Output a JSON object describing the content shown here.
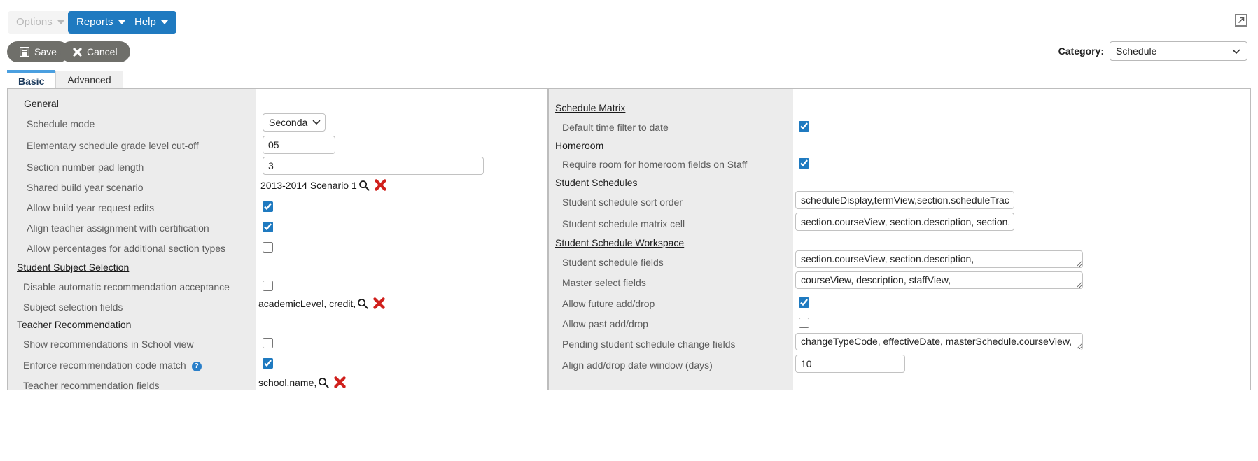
{
  "toolbar": {
    "options_label": "Options",
    "reports_label": "Reports",
    "help_label": "Help",
    "save_label": "Save",
    "cancel_label": "Cancel",
    "expand_icon": "expand-window-icon"
  },
  "category": {
    "label": "Category:",
    "value": "Schedule",
    "options": [
      "Schedule"
    ]
  },
  "tabs": [
    {
      "label": "Basic",
      "active": true
    },
    {
      "label": "Advanced",
      "active": false
    }
  ],
  "left_panel": {
    "sections": [
      {
        "title": "General",
        "rows": [
          {
            "label": "Schedule mode",
            "type": "select",
            "value": "Secondary",
            "options": [
              "Secondary"
            ]
          },
          {
            "label": "Elementary schedule grade level cut-off",
            "type": "text",
            "value": "05"
          },
          {
            "label": "Section number pad length",
            "type": "text",
            "value": "3"
          },
          {
            "label": "Shared build year scenario",
            "type": "picker",
            "value": "2013-2014 Scenario 1"
          },
          {
            "label": "Allow build year request edits",
            "type": "checkbox",
            "value": true
          },
          {
            "label": "Align teacher assignment with certification",
            "type": "checkbox",
            "value": true
          },
          {
            "label": "Allow percentages for additional section types",
            "type": "checkbox",
            "value": false
          }
        ]
      },
      {
        "title": "Student Subject Selection",
        "rows": [
          {
            "label": "Disable automatic recommendation acceptance",
            "type": "checkbox",
            "value": false
          },
          {
            "label": "Subject selection fields",
            "type": "picker",
            "value": "academicLevel, credit,"
          }
        ]
      },
      {
        "title": "Teacher Recommendation",
        "rows": [
          {
            "label": "Show recommendations in School view",
            "type": "checkbox",
            "value": false
          },
          {
            "label": "Enforce recommendation code match",
            "type": "checkbox",
            "value": true,
            "help": "?"
          },
          {
            "label": "Teacher recommendation fields",
            "type": "picker",
            "value": "school.name,"
          }
        ]
      }
    ]
  },
  "right_panel": {
    "sections": [
      {
        "title": "Schedule Matrix",
        "rows": [
          {
            "label": "Default time filter to date",
            "type": "checkbox",
            "value": true
          }
        ]
      },
      {
        "title": "Homeroom",
        "rows": [
          {
            "label": "Require room for homeroom fields on Staff",
            "type": "checkbox",
            "value": true
          }
        ]
      },
      {
        "title": "Student Schedules",
        "rows": [
          {
            "label": "Student schedule sort order",
            "type": "text",
            "value": "scheduleDisplay,termView,section.scheduleTrackId,sectio"
          },
          {
            "label": "Student schedule matrix cell",
            "type": "text",
            "value": "section.courseView, section.description, section.staffView"
          }
        ]
      },
      {
        "title": "Student Schedule Workspace",
        "rows": [
          {
            "label": "Student schedule fields",
            "type": "textarea",
            "value": "section.courseView, section.description,"
          },
          {
            "label": "Master select fields",
            "type": "textarea",
            "value": "courseView, description, staffView,"
          },
          {
            "label": "Allow future add/drop",
            "type": "checkbox",
            "value": true
          },
          {
            "label": "Allow past add/drop",
            "type": "checkbox",
            "value": false
          },
          {
            "label": "Pending student schedule change fields",
            "type": "textarea",
            "value": "changeTypeCode, effectiveDate, masterSchedule.courseView,"
          },
          {
            "label": "Align add/drop date window (days)",
            "type": "text",
            "value": "10"
          }
        ]
      }
    ]
  },
  "colors": {
    "accent": "#1f7ac0",
    "tab_active_bar": "#4a9fe0",
    "button_grey": "#6f6f6a",
    "panel_label_bg": "#ececec",
    "red_x": "#d0201c"
  }
}
